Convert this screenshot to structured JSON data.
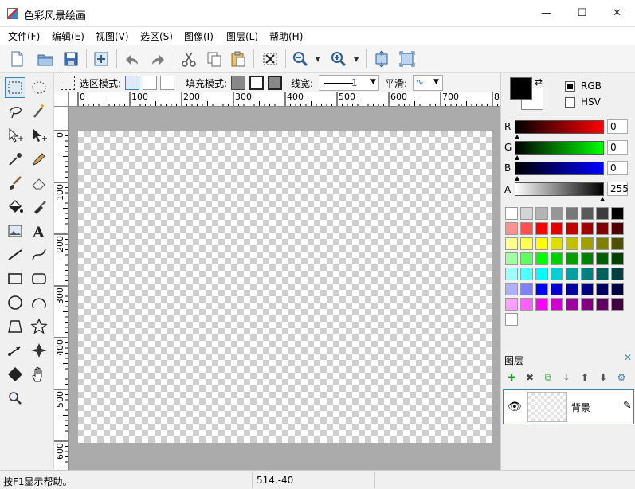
{
  "window": {
    "title": "色彩风景绘画",
    "min": "—",
    "max": "☐",
    "close": "✕"
  },
  "menu": [
    "文件(F)",
    "编辑(E)",
    "视图(V)",
    "选区(S)",
    "图像(I)",
    "图层(L)",
    "帮助(H)"
  ],
  "options": {
    "selection_mode_label": "选区模式:",
    "fill_mode_label": "填充模式:",
    "line_width_label": "线宽:",
    "line_width_value": "1",
    "smooth_label": "平滑:"
  },
  "ruler": {
    "h_labels": [
      "0",
      "100",
      "200",
      "300",
      "400",
      "500",
      "600",
      "700",
      "80"
    ],
    "v_labels": [
      "0",
      "100",
      "200",
      "300",
      "400",
      "500",
      "600"
    ]
  },
  "color": {
    "rgb_label": "RGB",
    "hsv_label": "HSV",
    "channels": [
      {
        "name": "R",
        "value": "0"
      },
      {
        "name": "G",
        "value": "0"
      },
      {
        "name": "B",
        "value": "0"
      },
      {
        "name": "A",
        "value": "255"
      }
    ],
    "palette": [
      "#ffffff",
      "#d4d4d4",
      "#b4b4b4",
      "#969696",
      "#787878",
      "#5a5a5a",
      "#3c3c3c",
      "#000000",
      "#ff9090",
      "#ff5050",
      "#ff0000",
      "#e00000",
      "#c00000",
      "#a00000",
      "#800000",
      "#500000",
      "#ffff90",
      "#ffff50",
      "#ffff00",
      "#e0e000",
      "#c0c000",
      "#a0a000",
      "#808000",
      "#505000",
      "#a0ffa0",
      "#60ff60",
      "#00ff00",
      "#00d000",
      "#00a000",
      "#008000",
      "#006000",
      "#004000",
      "#a0ffff",
      "#50ffff",
      "#00ffff",
      "#00d0d0",
      "#00a0a0",
      "#008080",
      "#006060",
      "#004040",
      "#b0b0ff",
      "#8080ff",
      "#0000ff",
      "#0000d0",
      "#0000a0",
      "#000080",
      "#000060",
      "#000040",
      "#ffa0ff",
      "#ff60ff",
      "#ff00ff",
      "#d000d0",
      "#a000a0",
      "#800080",
      "#600060",
      "#400040",
      "#ffffff"
    ]
  },
  "layers": {
    "title": "图层",
    "close": "✕",
    "items": [
      {
        "name": "背景"
      }
    ]
  },
  "status": {
    "message": "按F1显示帮助。",
    "position": "514,-40"
  }
}
